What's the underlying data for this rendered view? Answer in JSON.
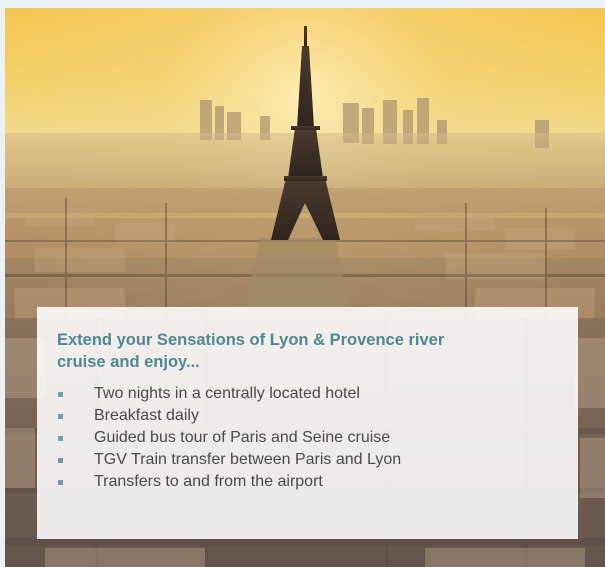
{
  "promo": {
    "heading": "Extend your Sensations of Lyon & Provence river cruise and enjoy...",
    "benefits": [
      "Two nights in a centrally located hotel",
      "Breakfast daily",
      "Guided bus tour of Paris and Seine cruise",
      "TGV Train transfer between Paris and Lyon",
      "Transfers to and from the airport"
    ]
  },
  "colors": {
    "heading": "#4e8a94",
    "bullet": "#6aa3ad",
    "text": "#4a4a4a",
    "frame": "#e9f2f6"
  },
  "icons": {
    "bullet": "square-bullet-icon"
  }
}
